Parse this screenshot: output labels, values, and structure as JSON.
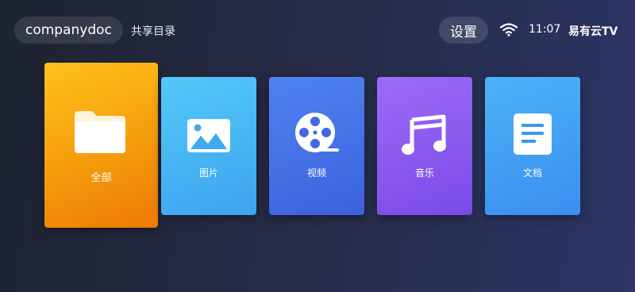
{
  "header": {
    "folder_name": "companydoc",
    "shared_dir_label": "共享目录",
    "settings_label": "设置",
    "time": "11:07",
    "brand": "易有云TV",
    "wifi_icon": "wifi-icon"
  },
  "categories": [
    {
      "label": "全部",
      "icon": "folder-icon",
      "selected": true
    },
    {
      "label": "图片",
      "icon": "image-icon",
      "selected": false
    },
    {
      "label": "视频",
      "icon": "film-reel-icon",
      "selected": false
    },
    {
      "label": "音乐",
      "icon": "music-note-icon",
      "selected": false
    },
    {
      "label": "文档",
      "icon": "document-icon",
      "selected": false
    }
  ],
  "colors": {
    "all": "#f7a70f",
    "images": "#45b1f3",
    "video": "#4670e6",
    "music": "#8a5cf0",
    "documents": "#439ff3"
  }
}
